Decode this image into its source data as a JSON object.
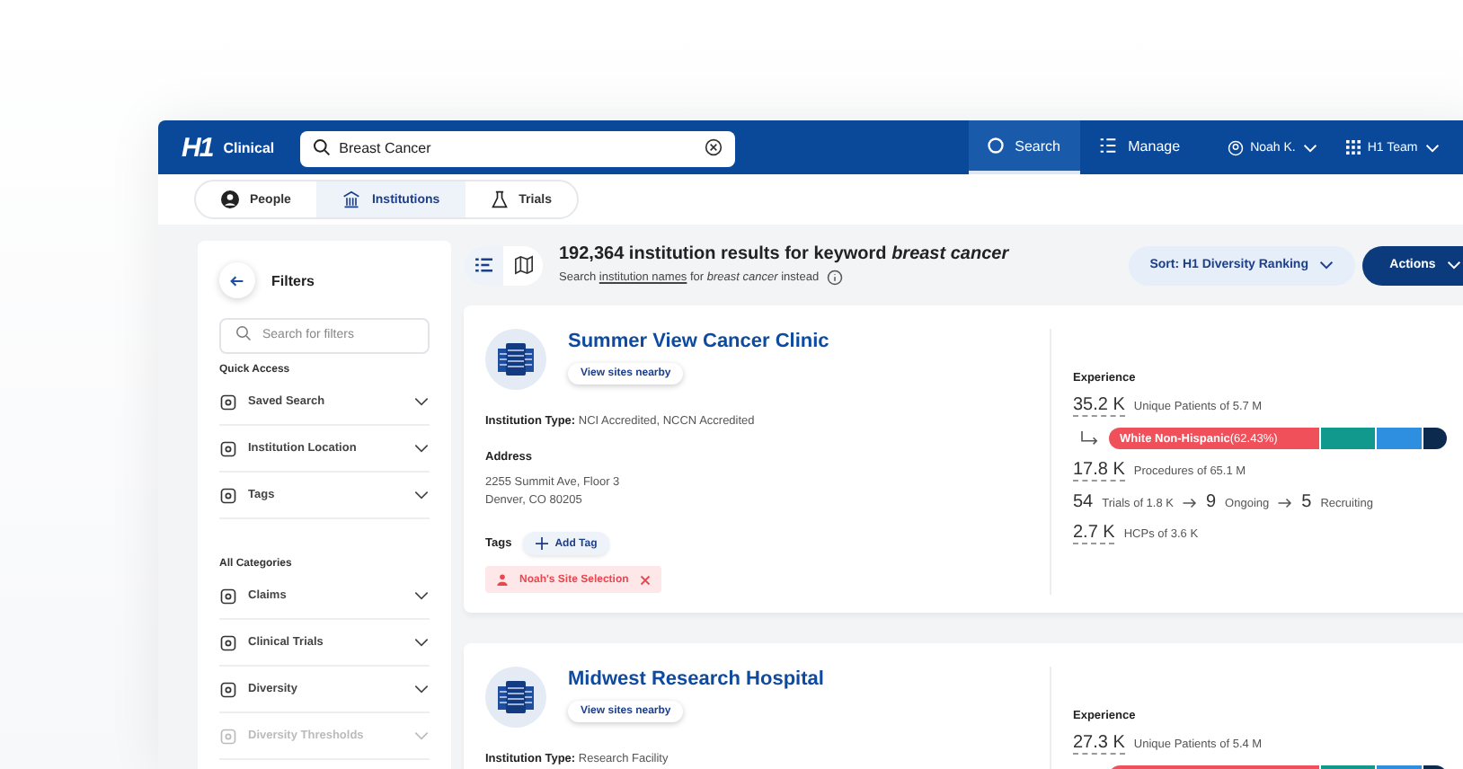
{
  "navbar": {
    "logo": "H1",
    "product": "Clinical",
    "search": {
      "value": "Breast Cancer"
    },
    "nav_items": [
      {
        "label": "Search",
        "selected": true
      },
      {
        "label": "Manage",
        "selected": false
      }
    ],
    "user": "Noah K.",
    "team": "H1 Team"
  },
  "subtabs": [
    {
      "label": "People",
      "selected": false
    },
    {
      "label": "Institutions",
      "selected": true
    },
    {
      "label": "Trials",
      "selected": false
    }
  ],
  "filters": {
    "title": "Filters",
    "search": {
      "placeholder": "Search for filters"
    },
    "sections": [
      {
        "title": "Quick Access",
        "items": [
          {
            "label": "Saved Search",
            "disabled": false
          },
          {
            "label": "Institution Location",
            "disabled": false
          },
          {
            "label": "Tags",
            "disabled": false
          }
        ]
      },
      {
        "title": "All Categories",
        "items": [
          {
            "label": "Claims",
            "disabled": false
          },
          {
            "label": "Clinical Trials",
            "disabled": false
          },
          {
            "label": "Diversity",
            "disabled": false
          },
          {
            "label": "Diversity Thresholds",
            "disabled": true
          }
        ]
      }
    ]
  },
  "results": {
    "view_toggle": [
      {
        "selected": true
      },
      {
        "selected": false
      }
    ],
    "heading": "192,364 institution results for keyword *breast cancer*",
    "subline": {
      "before": "Search",
      "link": "institution names",
      "after": "for *breast cancer* instead"
    },
    "sort": "Sort: H1 Diversity Ranking",
    "actions": "Actions",
    "cards": [
      {
        "name": "Summer View Cancer Clinic",
        "nearby": "View sites nearby",
        "type_label": "Institution Type:",
        "type_value": "NCI Accredited, NCCN Accredited",
        "address_label": "Address",
        "address_lines": [
          "2255 Summit Ave, Floor 3",
          "Denver, CO 80205"
        ],
        "tags_label": "Tags",
        "add_tag": "Add Tag",
        "tags": [
          "Noah's Site Selection"
        ],
        "experience_label": "Experience",
        "patients": {
          "value": "35.2 K",
          "text": "Unique Patients of 5.7 M"
        },
        "diversity": {
          "label": "**White Non-Hispanic**(62.43%)",
          "segments": [
            {
              "color": "#f0505a"
            },
            {
              "color": "#12998e"
            },
            {
              "color": "#2e8ee0"
            },
            {
              "color": "#0b2a4e"
            }
          ]
        },
        "procedures": {
          "value": "17.8 K",
          "text": "Procedures of 65.1 M"
        },
        "trials": {
          "value": "54",
          "text": "Trials of 1.8 K",
          "ongoing_value": "9",
          "ongoing": "Ongoing",
          "recruiting_value": "5",
          "recruiting": "Recruiting"
        },
        "hcps": {
          "value": "2.7 K",
          "text": "HCPs of 3.6 K"
        }
      },
      {
        "name": "Midwest Research Hospital",
        "nearby": "View sites nearby",
        "type_label": "Institution Type:",
        "type_value": "Research Facility",
        "experience_label": "Experience",
        "patients": {
          "value": "27.3 K",
          "text": "Unique Patients of 5.4 M"
        },
        "diversity": {
          "segments": [
            {
              "color": "#f0505a"
            },
            {
              "color": "#12998e"
            },
            {
              "color": "#2e8ee0"
            },
            {
              "color": "#0b2a4e"
            }
          ]
        }
      }
    ]
  }
}
